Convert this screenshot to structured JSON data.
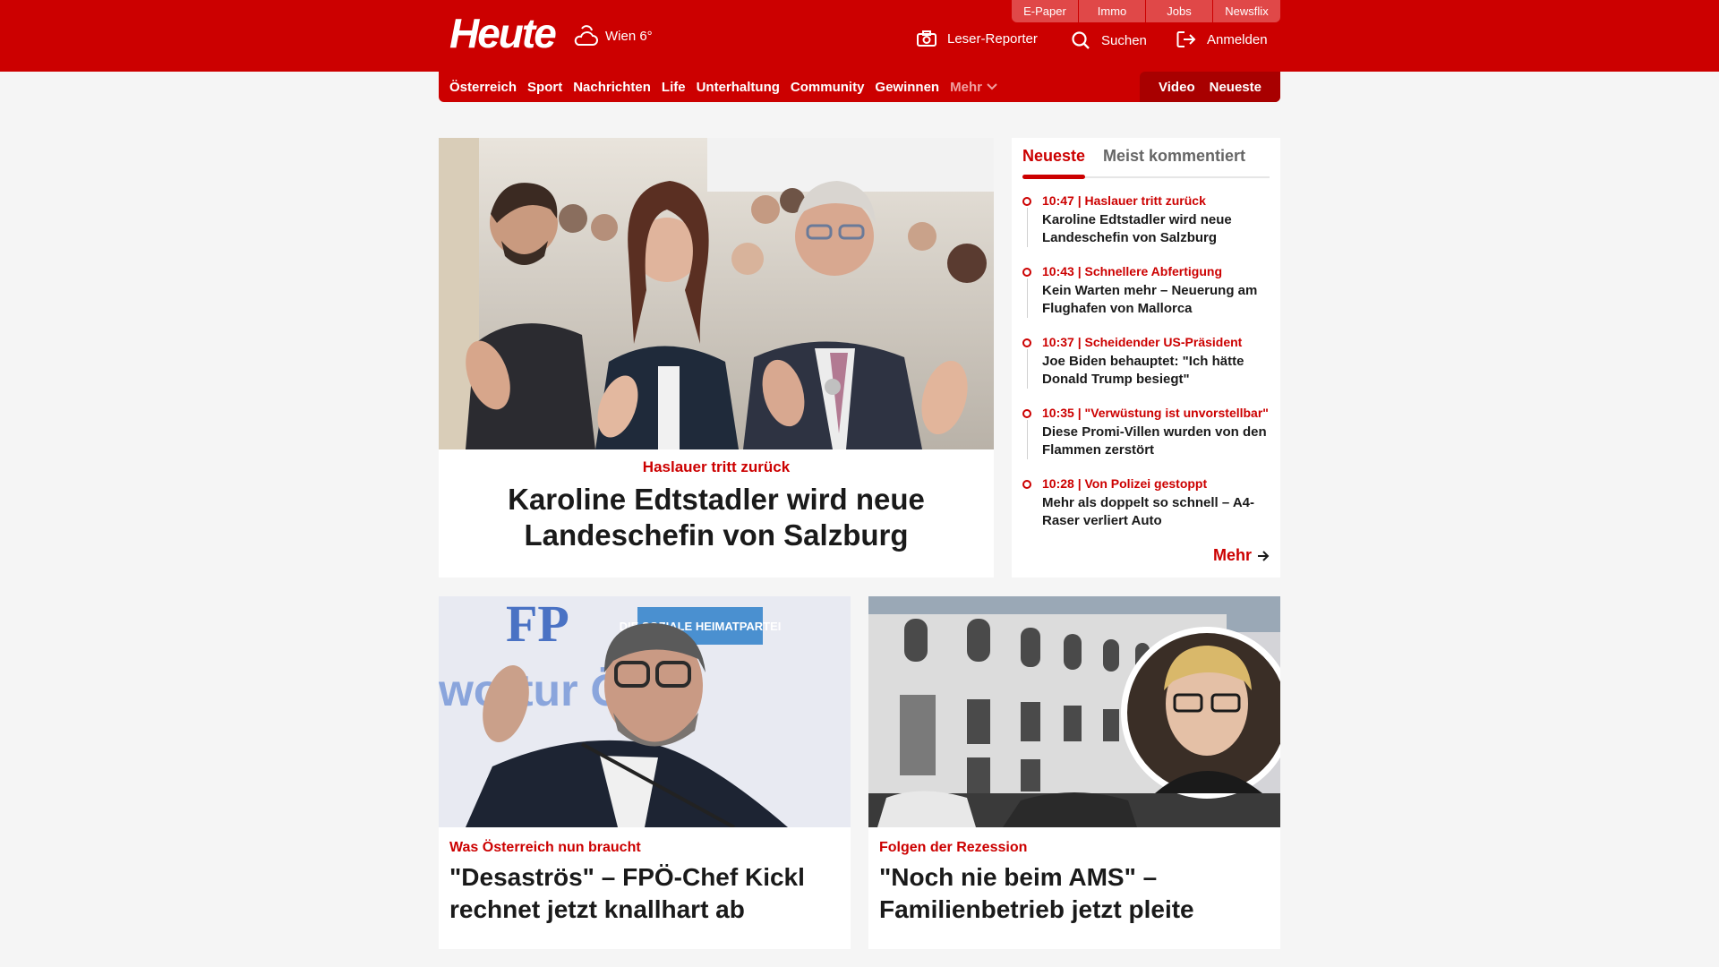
{
  "header": {
    "logo": "Heute",
    "weather": "Wien 6°",
    "brand_links": [
      "E-Paper",
      "Immo",
      "Jobs",
      "Newsflix"
    ],
    "leser_reporter": "Leser-Reporter",
    "search": "Suchen",
    "login": "Anmelden"
  },
  "nav": {
    "items": [
      "Österreich",
      "Sport",
      "Nachrichten",
      "Life",
      "Unterhaltung",
      "Community",
      "Gewinnen"
    ],
    "more": "Mehr",
    "video": "Video",
    "latest": "Neueste"
  },
  "hero": {
    "kicker": "Haslauer tritt zurück",
    "title": "Karoline Edtstadler wird neue Landeschefin von Salzburg"
  },
  "sidebar": {
    "tab_active": "Neueste",
    "tab_inactive": "Meist kommentiert",
    "items": [
      {
        "meta": "10:47 | Haslauer tritt zurück",
        "title": "Karoline Edtstadler wird neue Landeschefin von Salzburg"
      },
      {
        "meta": "10:43 | Schnellere Abfertigung",
        "title": "Kein Warten mehr – Neuerung am Flughafen von Mallorca"
      },
      {
        "meta": "10:37 | Scheidender US-Präsident",
        "title": "Joe Biden behauptet: \"Ich hätte Donald Trump besiegt\""
      },
      {
        "meta": "10:35 | \"Verwüstung ist unvorstellbar\"",
        "title": "Diese Promi-Villen wurden von den Flammen zerstört"
      },
      {
        "meta": "10:28 | Von Polizei gestoppt",
        "title": "Mehr als doppelt so schnell – A4-Raser verliert Auto"
      }
    ],
    "more": "Mehr"
  },
  "cards": [
    {
      "kicker": "Was Österreich nun braucht",
      "title": "\"Desaströs\" – FPÖ-Chef Kickl rechnet jetzt knallhart ab",
      "image_text": "wortur Öste",
      "image_logo": "FP",
      "image_banner": "DIE SOZIALE HEIMATPARTEI"
    },
    {
      "kicker": "Folgen der Rezession",
      "title": "\"Noch nie beim AMS\" – Familienbetrieb jetzt pleite"
    }
  ],
  "colors": {
    "brand": "#cc0000",
    "brand_dark": "#a80000",
    "page_bg": "#f5f5f5"
  }
}
